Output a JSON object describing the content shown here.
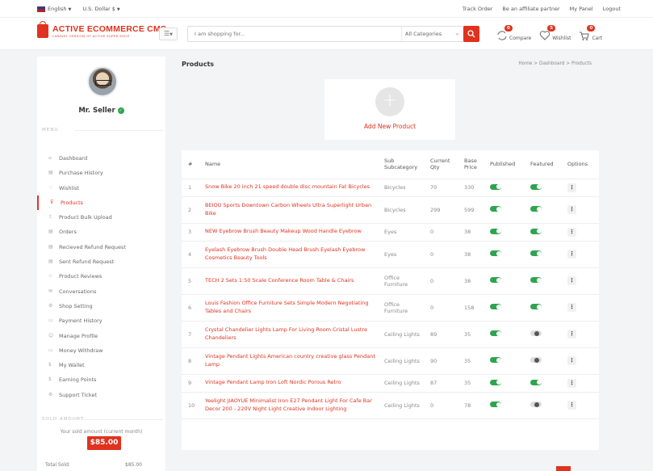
{
  "topbar": {
    "language": "English",
    "currency": "U.S. Dollar $",
    "links": [
      "Track Order",
      "Be an affiliate partner",
      "My Panel",
      "Logout"
    ]
  },
  "header": {
    "logo_title": "ACTIVE ECOMMERCE CMS",
    "logo_subtitle": "LARAVEL VERSION OF ACTIVE SUPER SHOP",
    "search_placeholder": "I am shopping for...",
    "category_select": "All Categories",
    "compare": {
      "label": "Compare",
      "count": "0"
    },
    "wishlist": {
      "label": "Wishlist",
      "count": "5"
    },
    "cart": {
      "label": "Cart",
      "count": "0"
    }
  },
  "sidebar": {
    "seller_name": "Mr. Seller",
    "menu_label": "MENU",
    "items": [
      {
        "label": "Dashboard",
        "icon": "⌂"
      },
      {
        "label": "Purchase History",
        "icon": "▤"
      },
      {
        "label": "Wishlist",
        "icon": "♡"
      },
      {
        "label": "Products",
        "icon": "⊽"
      },
      {
        "label": "Product Bulk Upload",
        "icon": "⇪"
      },
      {
        "label": "Orders",
        "icon": "▤"
      },
      {
        "label": "Recieved Refund Request",
        "icon": "▤"
      },
      {
        "label": "Sent Refund Request",
        "icon": "▤"
      },
      {
        "label": "Product Reviews",
        "icon": "☆"
      },
      {
        "label": "Conversations",
        "icon": "✉"
      },
      {
        "label": "Shop Setting",
        "icon": "⚙"
      },
      {
        "label": "Payment History",
        "icon": "▭"
      },
      {
        "label": "Manage Profile",
        "icon": "☺"
      },
      {
        "label": "Money Withdraw",
        "icon": "▭"
      },
      {
        "label": "My Wallet",
        "icon": "$"
      },
      {
        "label": "Earning Points",
        "icon": "$"
      },
      {
        "label": "Support Ticket",
        "icon": "⚙"
      }
    ],
    "sold_label": "SOLD AMOUNT",
    "sold_note": "Your sold amount (current month)",
    "sold_amount": "$85.00",
    "total_sold_label": "Total Sold:",
    "total_sold_value": "$85.00"
  },
  "main": {
    "title": "Products",
    "breadcrumb": "Home > Dashboard > Products",
    "add_new_label": "Add New Product",
    "columns": [
      "#",
      "Name",
      "Sub Subcategory",
      "Current Qty",
      "Base Price",
      "Published",
      "Featured",
      "Options"
    ],
    "rows": [
      {
        "n": "1",
        "name": "Snow Bike 20 inch 21 speed double disc mountain Fat Bicycles",
        "sub": "Bicycles",
        "qty": "70",
        "price": "330",
        "published": true,
        "featured": true
      },
      {
        "n": "2",
        "name": "BEIOU Sports Downtown Carbon Wheels Ultra Superlight Urban Bike",
        "sub": "Bicycles",
        "qty": "299",
        "price": "599",
        "published": true,
        "featured": true
      },
      {
        "n": "3",
        "name": "NEW Eyebrow Brush Beauty Makeup Wood Handle Eyebrow",
        "sub": "Eyes",
        "qty": "0",
        "price": "38",
        "published": true,
        "featured": true
      },
      {
        "n": "4",
        "name": "Eyelash Eyebrow Brush Double Head Brush Eyelash Eyebrow Cosmetics Beauty Tools",
        "sub": "Eyes",
        "qty": "0",
        "price": "38",
        "published": true,
        "featured": true
      },
      {
        "n": "5",
        "name": "TECH 2 Sets 1:50 Scale Conference Room Table & Chairs",
        "sub": "Office Furniture",
        "qty": "0",
        "price": "38",
        "published": true,
        "featured": true
      },
      {
        "n": "6",
        "name": "Louis Fashion Office Furniture Sets Simple Modern Negotiating Tables and Chairs",
        "sub": "Office Furniture",
        "qty": "0",
        "price": "158",
        "published": true,
        "featured": true
      },
      {
        "n": "7",
        "name": "Crystal Chandelier Lights Lamp For Living Room Cristal Lustre Chandeliers",
        "sub": "Ceiling Lights",
        "qty": "89",
        "price": "35",
        "published": true,
        "featured": false
      },
      {
        "n": "8",
        "name": "Vintage Pendant Lights American country creative glass Pendant Lamp",
        "sub": "Ceiling Lights",
        "qty": "90",
        "price": "35",
        "published": true,
        "featured": false
      },
      {
        "n": "9",
        "name": "Vintage Pendant Lamp Iron Loft Nordic Porous Retro",
        "sub": "Ceiling Lights",
        "qty": "87",
        "price": "35",
        "published": true,
        "featured": true
      },
      {
        "n": "10",
        "name": "Yeelight JIAOYUE Minimalist Iron E27 Pendant Light For Cafe Bar Decor 200 - 220V Night Light Creative Indoor Lighting",
        "sub": "Ceiling Lights",
        "qty": "0",
        "price": "78",
        "published": true,
        "featured": false
      }
    ],
    "options_glyph": "⋮"
  },
  "colors": {
    "accent": "#e0321e",
    "toggle_on": "#2ea44f"
  }
}
